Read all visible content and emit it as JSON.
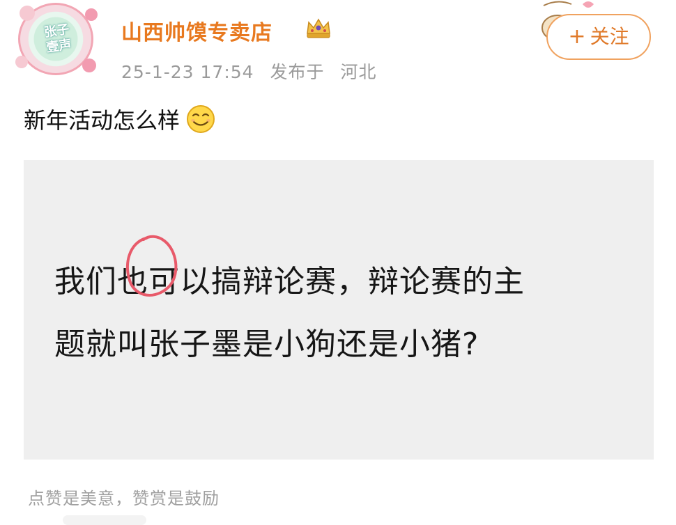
{
  "header": {
    "avatar_text_line1": "张子",
    "avatar_text_line2": "壹声",
    "shop_name": "山西帅馍专卖店",
    "badge_icon": "crown-badge-icon",
    "timestamp": "25-1-23 17:54",
    "published_label": "发布于",
    "location": "河北",
    "follow_label": "关注",
    "follow_plus": "+"
  },
  "post": {
    "text": "新年活动怎么样",
    "emoji_icon": "smirk-emoji-icon"
  },
  "image": {
    "line1": "我们也可以搞辩论赛，辩论赛的主",
    "line2": "题就叫张子墨是小狗还是小猪?",
    "annotation_color": "#e85a6a"
  },
  "footer": {
    "hint": "点赞是美意，赞赏是鼓励"
  },
  "colors": {
    "shop_name": "#e8791f",
    "follow_border": "#f0a25f",
    "meta_text": "#9a9a9a",
    "card_bg": "#efefef"
  }
}
